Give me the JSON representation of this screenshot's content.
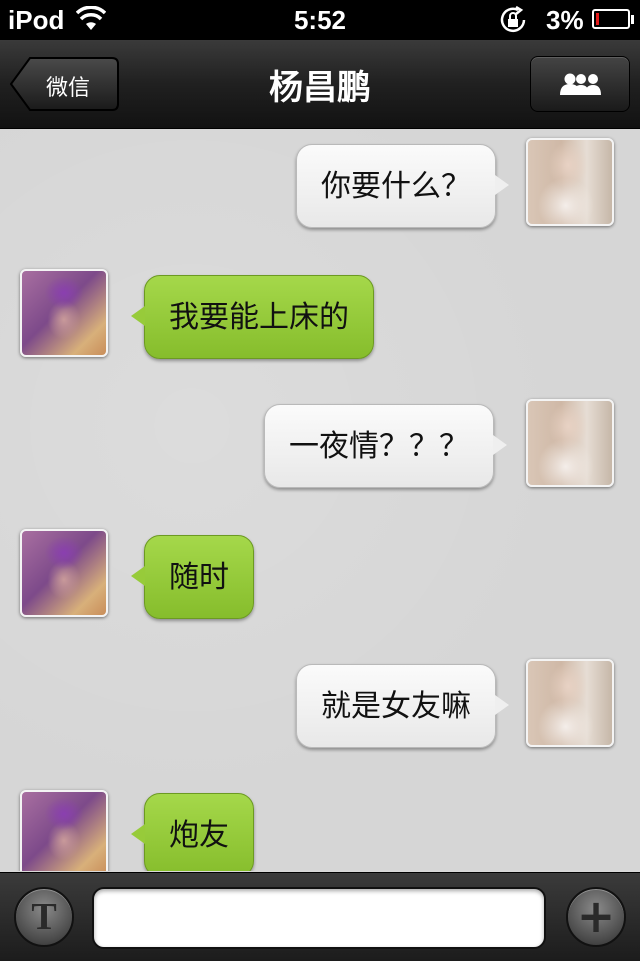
{
  "status_bar": {
    "carrier": "iPod",
    "time": "5:52",
    "battery_percent": "3%",
    "battery_level": 0.03,
    "icons": [
      "wifi-icon",
      "rotation-lock-icon",
      "battery-icon"
    ]
  },
  "nav": {
    "back_label": "微信",
    "title": "杨昌鹏",
    "right_icon": "contacts-icon"
  },
  "messages": [
    {
      "side": "out",
      "text": "你要什么？"
    },
    {
      "side": "in",
      "text": "我要能上床的"
    },
    {
      "side": "out",
      "text": "一夜情？？？"
    },
    {
      "side": "in",
      "text": "随时"
    },
    {
      "side": "out",
      "text": "就是女友嘛"
    },
    {
      "side": "in",
      "text": "炮友"
    }
  ],
  "input_bar": {
    "left_icon": "text-mode-icon",
    "left_glyph": "T",
    "input_value": "",
    "input_placeholder": "",
    "right_icon": "add-icon",
    "right_glyph": "+"
  },
  "colors": {
    "incoming_bubble": "#97cb3a",
    "outgoing_bubble": "#f2f2f2",
    "battery_low": "#e21b1b"
  }
}
